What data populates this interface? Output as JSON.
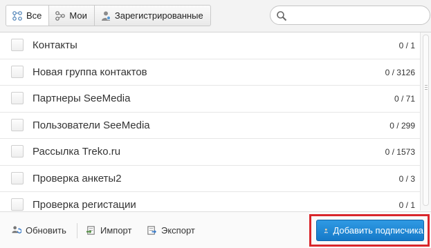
{
  "tabs": [
    {
      "label": "Все",
      "icon": "contacts-all-icon",
      "active": true
    },
    {
      "label": "Мои",
      "icon": "contacts-mine-icon",
      "active": false
    },
    {
      "label": "Зарегистрированные",
      "icon": "registered-users-icon",
      "active": false
    }
  ],
  "search": {
    "placeholder": "",
    "value": ""
  },
  "groups": [
    {
      "name": "Контакты",
      "count": "0 / 1"
    },
    {
      "name": "Новая группа контактов",
      "count": "0 / 3126"
    },
    {
      "name": "Партнеры SeeMedia",
      "count": "0 / 71"
    },
    {
      "name": "Пользователи SeeMedia",
      "count": "0 / 299"
    },
    {
      "name": "Рассылка Treko.ru",
      "count": "0 / 1573"
    },
    {
      "name": "Проверка анкеты2",
      "count": "0 / 3"
    },
    {
      "name": "Проверка регистации",
      "count": "0 / 1"
    }
  ],
  "toolbar": {
    "refresh_label": "Обновить",
    "import_label": "Импорт",
    "export_label": "Экспорт",
    "add_subscriber_label": "Добавить подписчика"
  },
  "colors": {
    "accent": "#1f88d6",
    "highlight": "#d9262b"
  }
}
